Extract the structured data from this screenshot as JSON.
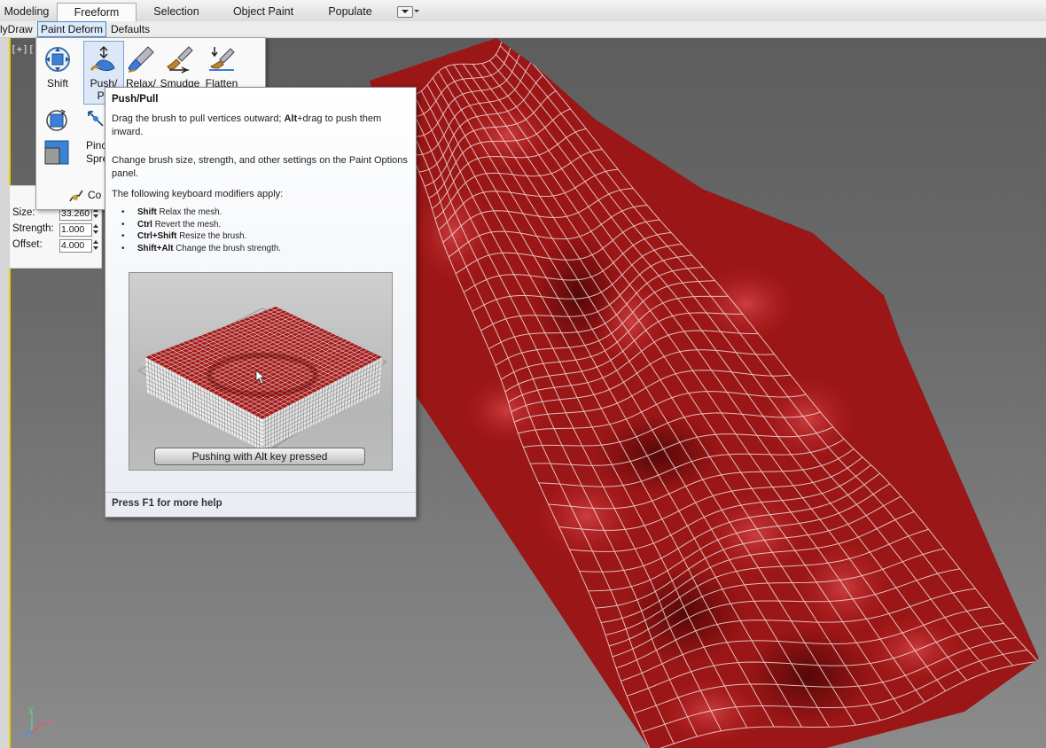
{
  "ribbon": {
    "tabs": [
      {
        "label": "Modeling",
        "active": false
      },
      {
        "label": "Freeform",
        "active": true
      },
      {
        "label": "Selection",
        "active": false
      },
      {
        "label": "Object Paint",
        "active": false
      },
      {
        "label": "Populate",
        "active": false
      }
    ]
  },
  "panel_tabs": [
    {
      "label": "lyDraw",
      "active": false
    },
    {
      "label": "Paint Deform",
      "active": true
    },
    {
      "label": "Defaults",
      "active": false
    }
  ],
  "viewport": {
    "label": "[+][",
    "accent_color": "#e5d400",
    "mesh_color": "#8c1414"
  },
  "tools": {
    "shift": "Shift",
    "push_pull": "Push/\nPu",
    "relax": "Relax/",
    "smudge": "Smudge",
    "flatten": "Flatten",
    "pinch": "Pinc",
    "spread": "Spre",
    "con": "Co"
  },
  "params": [
    {
      "label": "Size:",
      "value": "33.260"
    },
    {
      "label": "Strength:",
      "value": "1.000"
    },
    {
      "label": "Offset:",
      "value": "4.000"
    }
  ],
  "tooltip": {
    "title": "Push/Pull",
    "desc1_pre": "Drag the brush to pull vertices outward; ",
    "desc1_bold": "Alt",
    "desc1_post": "+drag to push them inward.",
    "desc2": "Change brush size, strength, and other settings on the Paint Options panel.",
    "modifiers_intro": "The following keyboard modifiers apply:",
    "modifiers": [
      {
        "key": "Shift",
        "text": " Relax the mesh."
      },
      {
        "key": "Ctrl",
        "text": " Revert the mesh."
      },
      {
        "key": "Ctrl+Shift",
        "text": " Resize the brush."
      },
      {
        "key": "Shift+Alt",
        "text": " Change the brush strength."
      }
    ],
    "image_caption": "Pushing with Alt key pressed",
    "footer": "Press F1 for more help"
  }
}
